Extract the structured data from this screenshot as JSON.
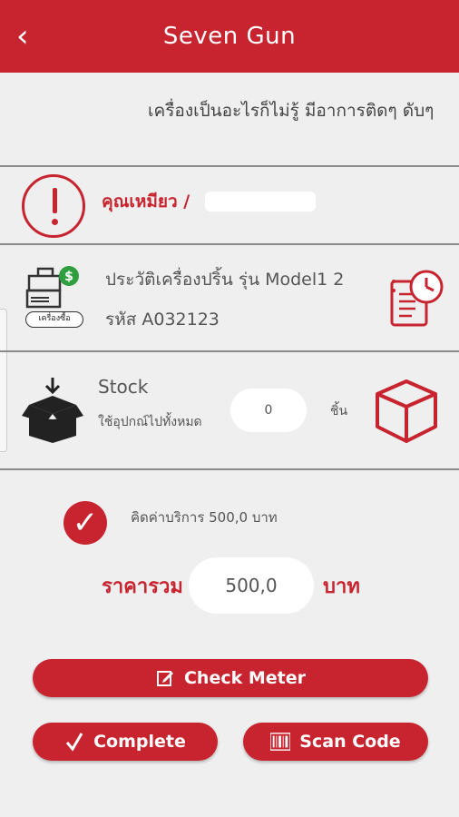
{
  "header": {
    "title": "Seven Gun",
    "back_glyph": "‹"
  },
  "job": {
    "description": "เครื่องเป็นอะไรก็ไม่รู้ มีอาการติดๆ ดับๆ"
  },
  "customer": {
    "name": "คุณเหมียว /"
  },
  "printer": {
    "tag": "เครื่องซื้อ",
    "history_title": "ประวัติเครื่องปริ้น รุ่น Model1 2",
    "code": "รหัส A032123"
  },
  "stock": {
    "label": "Stock",
    "used_all": "ใช้อุปกณ์ไปทั้งหมด",
    "quantity": "0",
    "unit": "ชิ้น"
  },
  "service": {
    "checked": true,
    "text": "คิดค่าบริการ 500,0 บาท"
  },
  "total": {
    "label": "ราคารวม",
    "value": "500,0",
    "unit": "บาท"
  },
  "buttons": {
    "check_meter": "Check Meter",
    "complete": "Complete",
    "scan_code": "Scan Code"
  },
  "colors": {
    "accent": "#c8242f",
    "background": "#efefef"
  }
}
